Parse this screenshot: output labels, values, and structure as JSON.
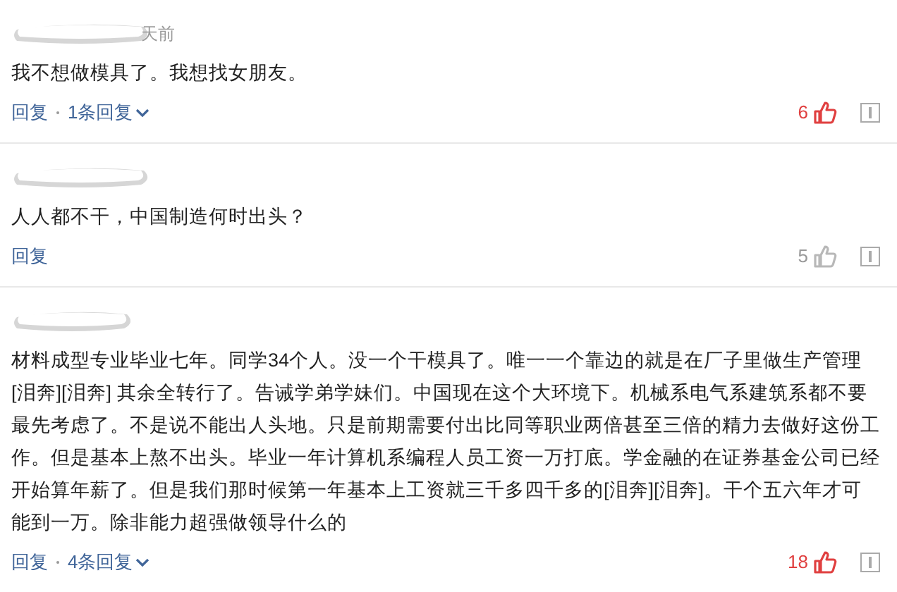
{
  "comments": [
    {
      "time": "天前",
      "text": "我不想做模具了。我想找女朋友。",
      "reply": "回复",
      "replies": "1条回复",
      "likes": "6",
      "liked": true
    },
    {
      "text": "人人都不干，中国制造何时出头？",
      "reply": "回复",
      "likes": "5",
      "liked": false
    },
    {
      "text": "材料成型专业毕业七年。同学34个人。没一个干模具了。唯一一个靠边的就是在厂子里做生产管理[泪奔][泪奔] 其余全转行了。告诫学弟学妹们。中国现在这个大环境下。机械系电气系建筑系都不要最先考虑了。不是说不能出人头地。只是前期需要付出比同等职业两倍甚至三倍的精力去做好这份工作。但是基本上熬不出头。毕业一年计算机系编程人员工资一万打底。学金融的在证券基金公司已经开始算年薪了。但是我们那时候第一年基本上工资就三千多四千多的[泪奔][泪奔]。干个五六年才可能到一万。除非能力超强做领导什么的",
      "reply": "回复",
      "replies": "4条回复",
      "likes": "18",
      "liked": true
    }
  ]
}
